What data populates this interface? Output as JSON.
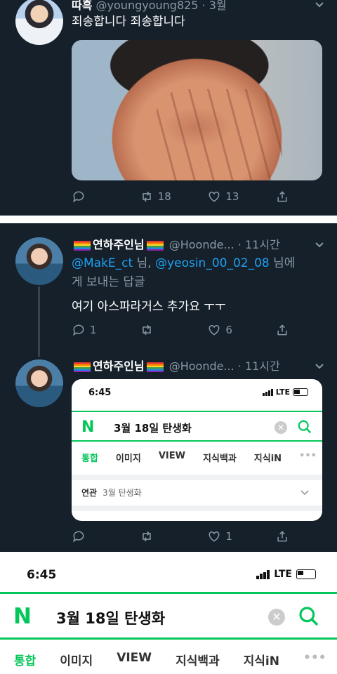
{
  "tweet1": {
    "display_name": "따흑",
    "handle": "@youngyoung825",
    "time": "3월",
    "text": "죄송합니다 죄송합니다",
    "reply_count": "",
    "retweet_count": "18",
    "like_count": "13"
  },
  "tweet2": {
    "display_name": "연하주인님",
    "handle": "@Hoonde...",
    "time": "11시간",
    "mention1": "@MakE_ct",
    "mention_sep": " 님, ",
    "mention2": "@yeosin_00_02_08",
    "mention_tail": " 님에",
    "mention_line2": "게 보내는 답글",
    "text": "여기 아스파라거스 추가요 ㅜㅜ",
    "reply_count": "1",
    "retweet_count": "",
    "like_count": "6"
  },
  "tweet3": {
    "display_name": "연하주인님",
    "handle": "@Hoonde...",
    "time": "11시간",
    "reply_count": "",
    "retweet_count": "",
    "like_count": "1"
  },
  "card": {
    "status_time": "6:45",
    "network": "LTE",
    "logo": "N",
    "query": "3월 18일 탄생화",
    "tabs": [
      "통합",
      "이미지",
      "VIEW",
      "지식백과",
      "지식iN",
      "•••"
    ],
    "related_label": "연관",
    "related_value": "3월 탄생화"
  },
  "bottom": {
    "status_time": "6:45",
    "network": "LTE",
    "logo": "N",
    "query": "3월 18일 탄생화",
    "tabs": [
      "통합",
      "이미지",
      "VIEW",
      "지식백과",
      "지식iN",
      "•••"
    ]
  },
  "colors": {
    "twitter_dark_bg": "#15202b",
    "twitter_blue": "#1da1f2",
    "naver_green": "#03c75a"
  }
}
